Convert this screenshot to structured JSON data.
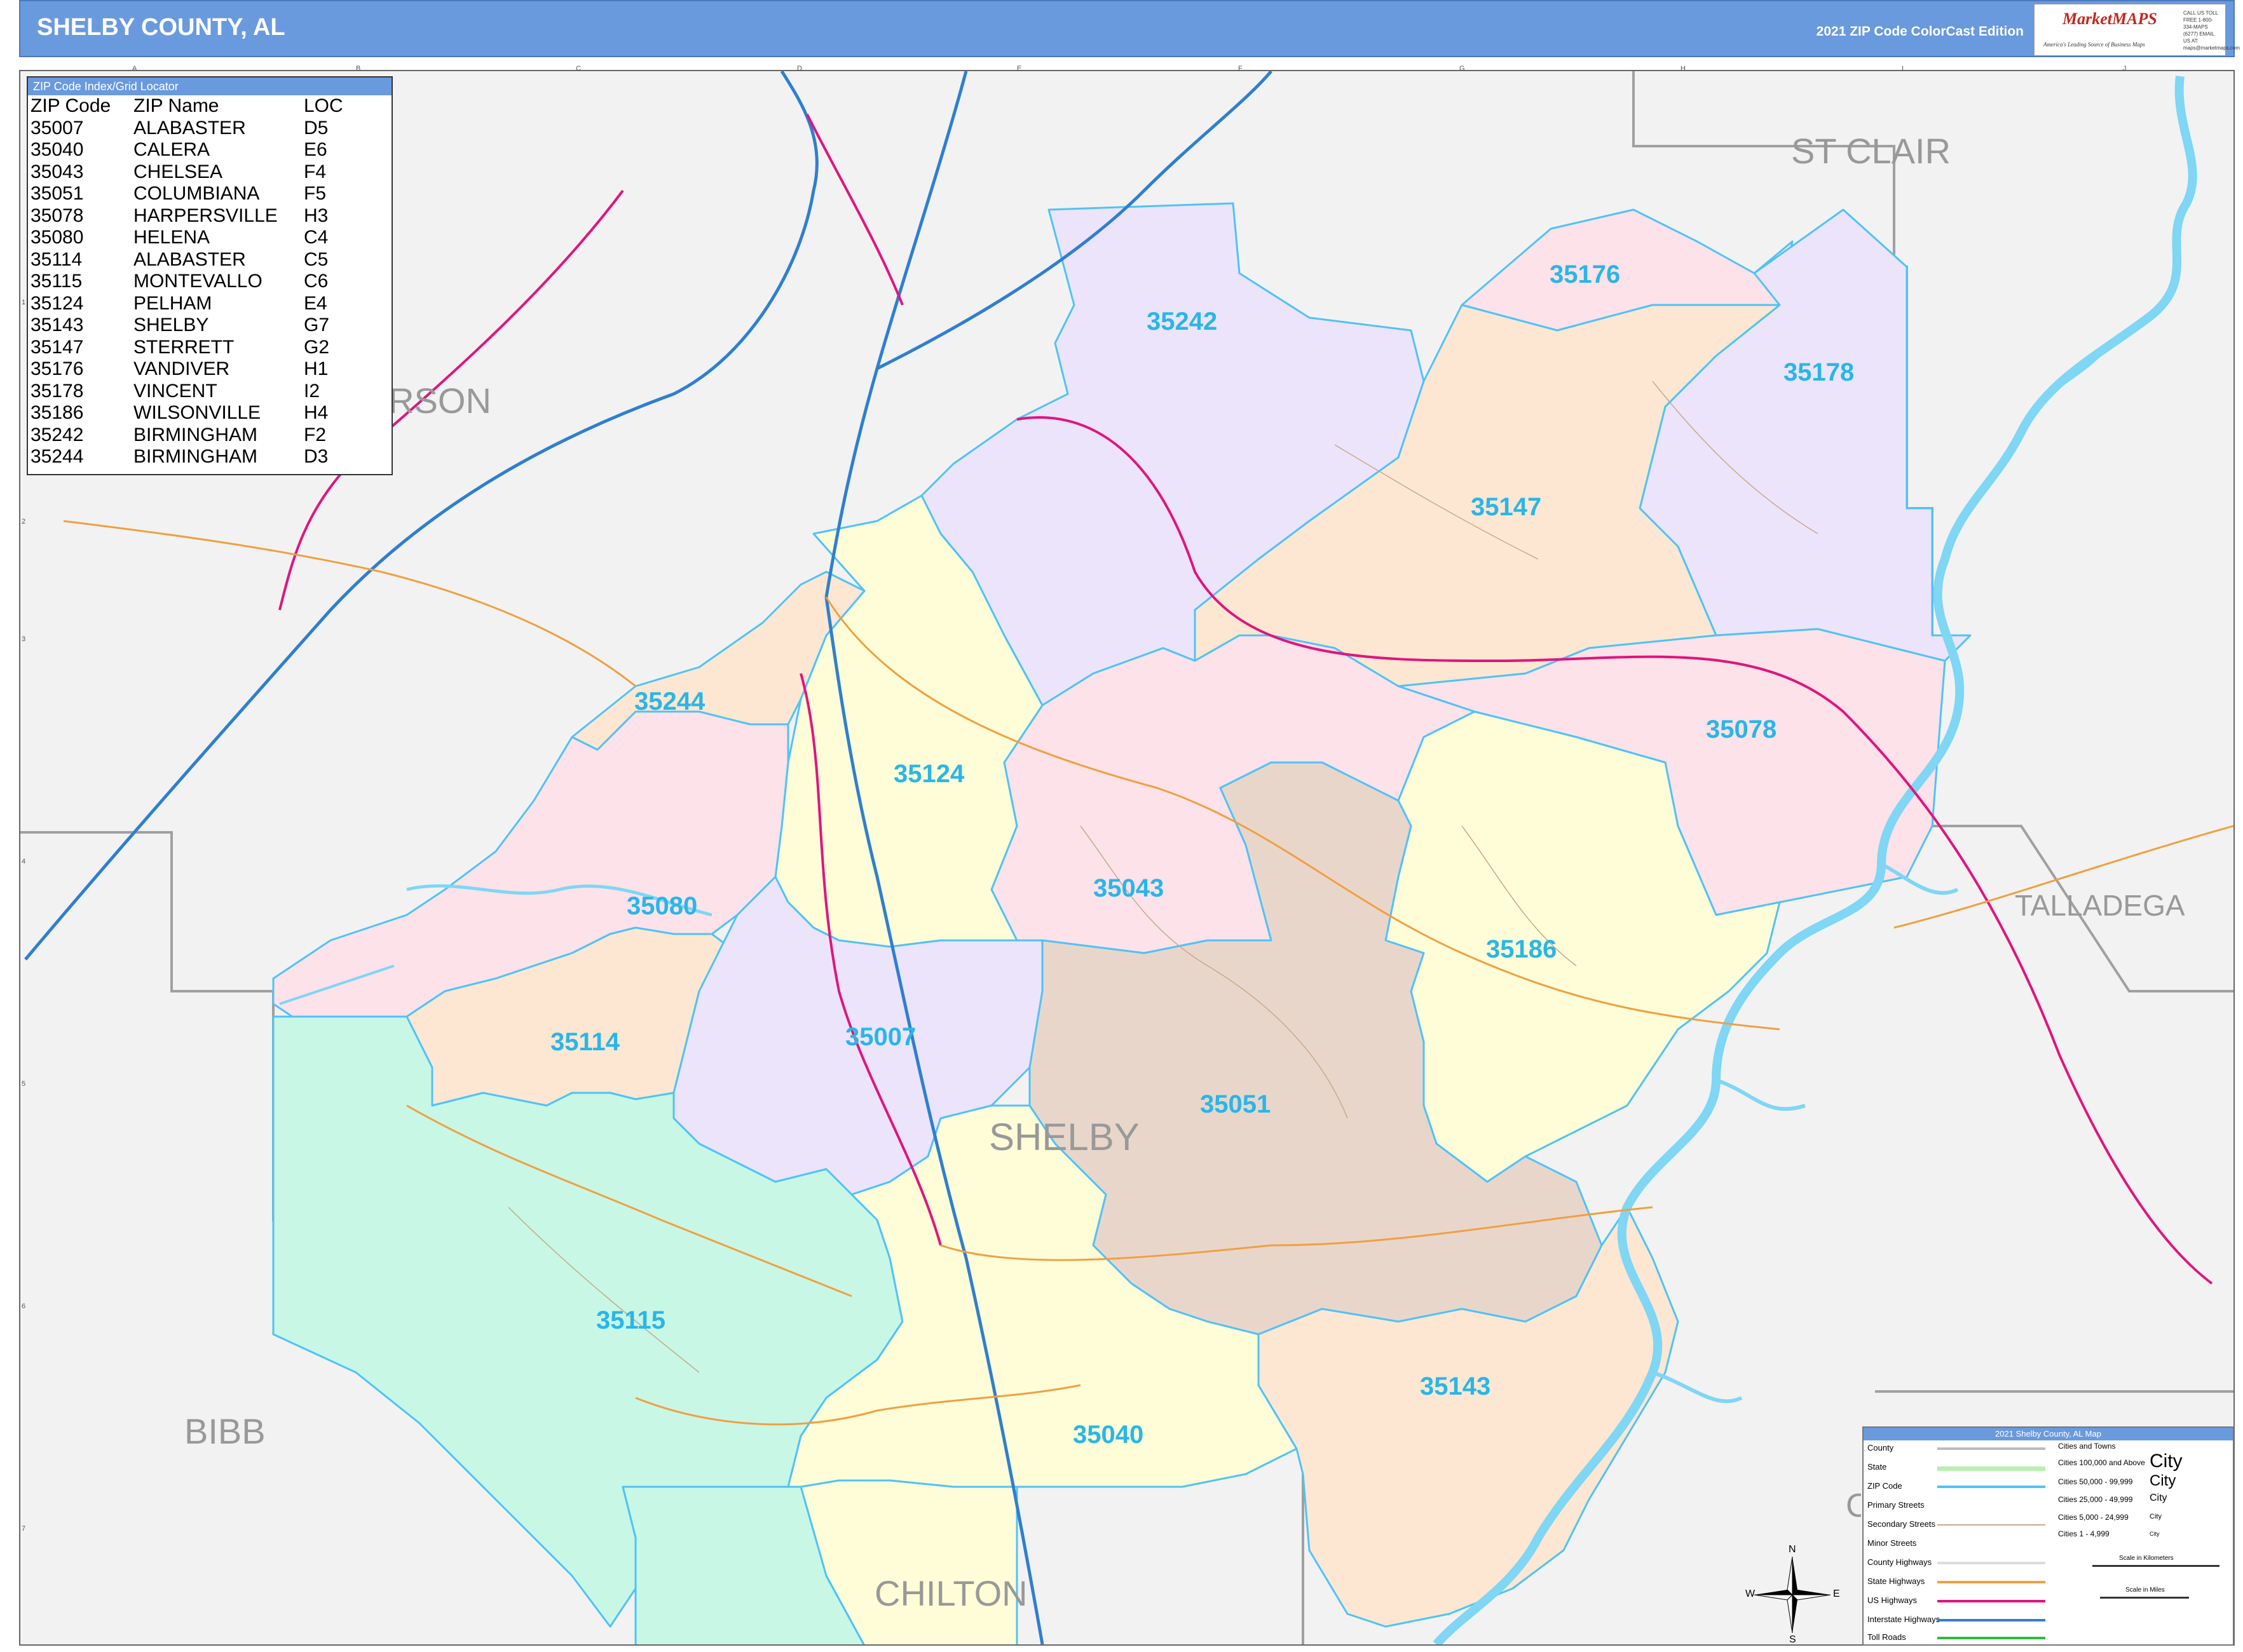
{
  "header": {
    "title": "SHELBY COUNTY, AL",
    "edition": "2021 ZIP Code ColorCast Edition",
    "logo_text": "MarketMAPS",
    "logo_tagline": "America's Leading Source of Business Maps",
    "logo_contact": "CALL US TOLL FREE 1-800-334-MAPS (6277) EMAIL US AT: maps@marketmaps.com"
  },
  "zip_index": {
    "title": "ZIP Code Index/Grid Locator",
    "columns": [
      "ZIP Code",
      "ZIP Name",
      "LOC"
    ],
    "rows": [
      [
        "35007",
        "ALABASTER",
        "D5"
      ],
      [
        "35040",
        "CALERA",
        "E6"
      ],
      [
        "35043",
        "CHELSEA",
        "F4"
      ],
      [
        "35051",
        "COLUMBIANA",
        "F5"
      ],
      [
        "35078",
        "HARPERSVILLE",
        "H3"
      ],
      [
        "35080",
        "HELENA",
        "C4"
      ],
      [
        "35114",
        "ALABASTER",
        "C5"
      ],
      [
        "35115",
        "MONTEVALLO",
        "C6"
      ],
      [
        "35124",
        "PELHAM",
        "E4"
      ],
      [
        "35143",
        "SHELBY",
        "G7"
      ],
      [
        "35147",
        "STERRETT",
        "G2"
      ],
      [
        "35176",
        "VANDIVER",
        "H1"
      ],
      [
        "35178",
        "VINCENT",
        "I2"
      ],
      [
        "35186",
        "WILSONVILLE",
        "H4"
      ],
      [
        "35242",
        "BIRMINGHAM",
        "F2"
      ],
      [
        "35244",
        "BIRMINGHAM",
        "D3"
      ]
    ]
  },
  "map": {
    "county_labels": {
      "shelby": "SHELBY",
      "st_clair": "ST CLAIR",
      "jefferson": "JEFFERSON",
      "talladega": "TALLADEGA",
      "bibb": "BIBB",
      "chilton": "CHILTON",
      "coosa": "COOSA"
    },
    "zip_labels": {
      "z35242": "35242",
      "z35176": "35176",
      "z35178": "35178",
      "z35147": "35147",
      "z35244": "35244",
      "z35124": "35124",
      "z35078": "35078",
      "z35043": "35043",
      "z35080": "35080",
      "z35186": "35186",
      "z35114": "35114",
      "z35007": "35007",
      "z35051": "35051",
      "z35115": "35115",
      "z35143": "35143",
      "z35040": "35040"
    },
    "colors": {
      "zip_label": "#29b6e8",
      "zip_border": "#4fc3f7",
      "water": "#7fd6f5",
      "interstate": "#2f7fd0",
      "us_highway": "#e0157e",
      "state_highway": "#f0a040",
      "county_border": "#999999",
      "outside": "#f2f2f2"
    },
    "grid_columns": [
      "A",
      "B",
      "C",
      "D",
      "E",
      "F",
      "G",
      "H",
      "I",
      "J"
    ],
    "grid_rows": [
      "1",
      "2",
      "3",
      "4",
      "5",
      "6",
      "7"
    ],
    "compass": {
      "n": "N",
      "s": "S",
      "e": "E",
      "w": "W"
    }
  },
  "legend": {
    "title": "2021 Shelby County, AL Map",
    "items": [
      "County",
      "State",
      "ZIP Code",
      "Primary Streets",
      "Secondary Streets",
      "Minor Streets",
      "County Highways",
      "State Highways",
      "US Highways",
      "Interstate Highways",
      "Toll Roads"
    ],
    "cities_title": "Cities and Towns",
    "cities": [
      [
        "Cities 100,000 and Above",
        "City"
      ],
      [
        "Cities 50,000 - 99,999",
        "City"
      ],
      [
        "Cities 25,000 - 49,999",
        "City"
      ],
      [
        "Cities 5,000 - 24,999",
        "City"
      ],
      [
        "Cities 1 - 4,999",
        "City"
      ]
    ],
    "scale_km": "Scale in Kilometers",
    "scale_mi": "Scale in Miles"
  }
}
